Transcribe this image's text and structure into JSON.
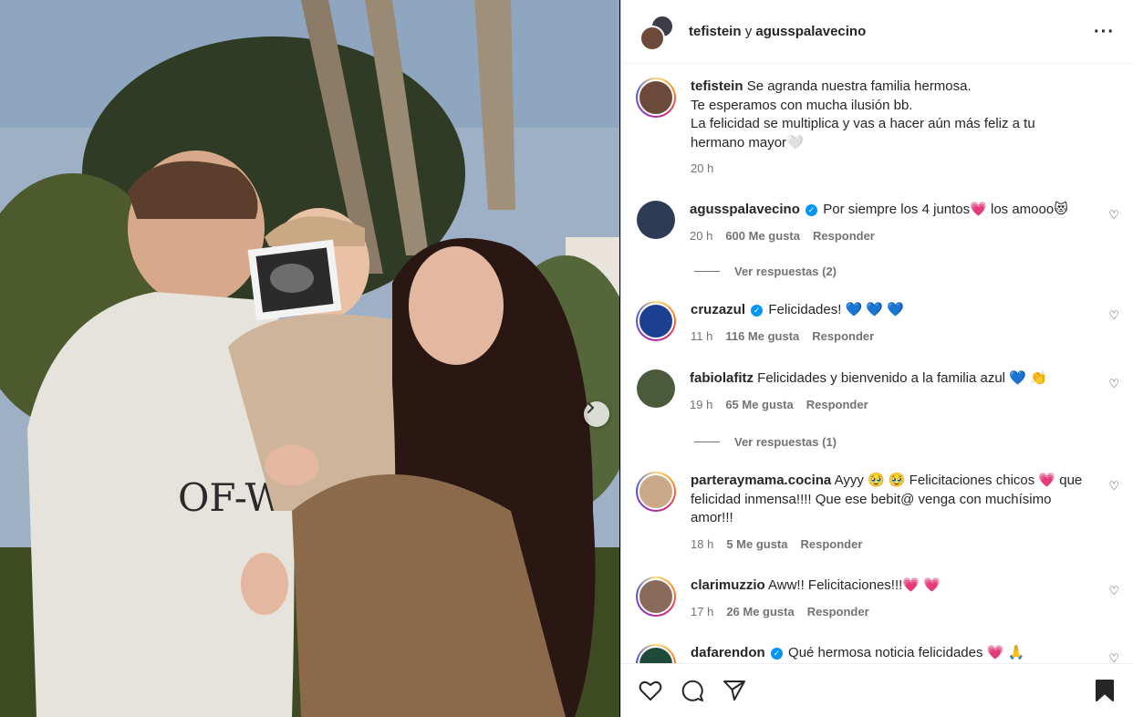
{
  "header": {
    "user1": "tefistein",
    "joiner": "y",
    "user2": "agusspalavecino"
  },
  "caption": {
    "user": "tefistein",
    "line1": "Se agranda nuestra familia hermosa.",
    "line2": "Te esperamos con mucha ilusión bb.",
    "line3": "La felicidad se multiplica y vas a hacer aún más feliz a tu",
    "line4": "hermano mayor🤍",
    "time": "20 h"
  },
  "comments": [
    {
      "user": "agusspalavecino",
      "text": "Por siempre los 4 juntos💗  los amooo😻",
      "time": "20 h",
      "likes": "600 Me gusta",
      "reply": "Responder",
      "replies": "Ver respuestas (2)",
      "avatar_color": "#2e3b55"
    },
    {
      "user": "cruzazul",
      "text": "Felicidades! 💙 💙 💙",
      "time": "11 h",
      "likes": "116 Me gusta",
      "reply": "Responder",
      "avatar_color": "#1d3f8f"
    },
    {
      "user": "fabiolafitz",
      "text": "Felicidades y bienvenido a la familia azul 💙 👏",
      "time": "19 h",
      "likes": "65 Me gusta",
      "reply": "Responder",
      "replies": "Ver respuestas (1)",
      "avatar_color": "#4a5a3a"
    },
    {
      "user": "parteraymama.cocina",
      "text": "Ayyy 🥹 🥹  Felicitaciones chicos 💗  que felicidad inmensa!!!! Que ese bebit@ venga con muchísimo amor!!!",
      "time": "18 h",
      "likes": "5 Me gusta",
      "reply": "Responder",
      "avatar_color": "#c9a98a"
    },
    {
      "user": "clarimuzzio",
      "text": "Aww!! Felicitaciones!!!💗 💗",
      "time": "17 h",
      "likes": "26 Me gusta",
      "reply": "Responder",
      "avatar_color": "#8a6a5a"
    },
    {
      "user": "dafarendon",
      "text": "Qué hermosa noticia felicidades 💗 🙏",
      "avatar_color": "#1e4a3a"
    }
  ],
  "icons": {
    "like": "heart-icon",
    "comment": "comment-icon",
    "share": "share-icon",
    "save": "bookmark-icon",
    "more": "more-icon",
    "next": "chevron-right-icon"
  },
  "colors": {
    "verified": "#0095f6",
    "text": "#262626",
    "muted": "#737373"
  }
}
